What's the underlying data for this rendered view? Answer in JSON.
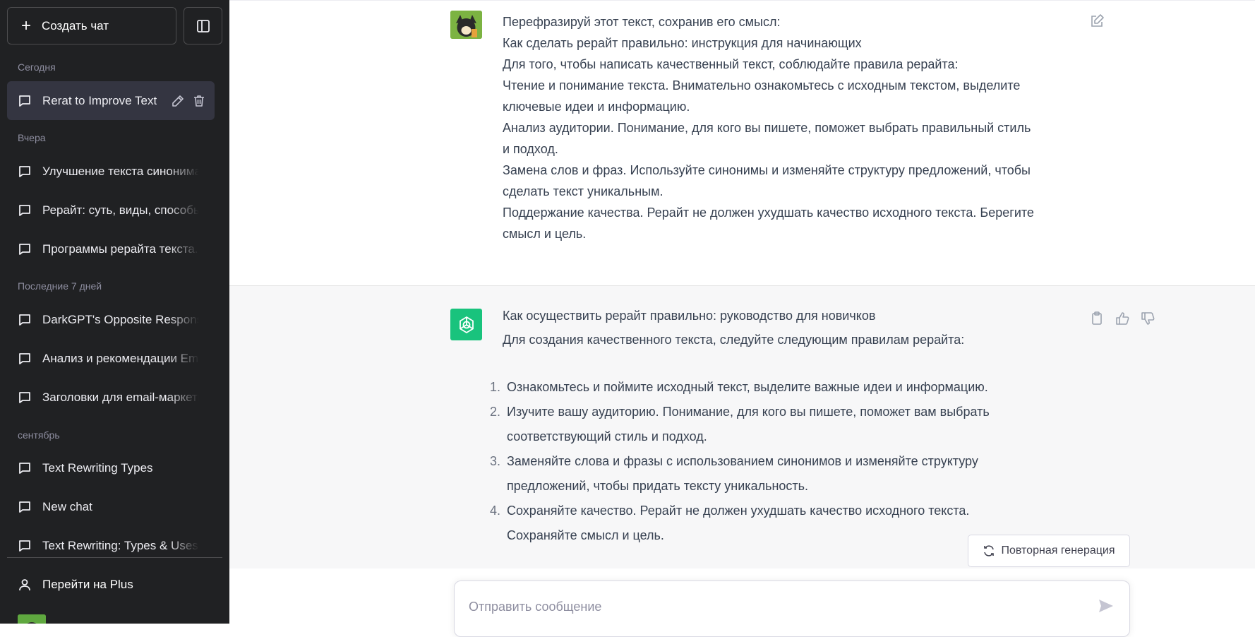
{
  "sidebar": {
    "new_chat_label": "Создать чат",
    "sections": {
      "today": "Сегодня",
      "yesterday": "Вчера",
      "last7": "Последние 7 дней",
      "september": "сентябрь"
    },
    "items": [
      {
        "label": "Rerat to Improve Text"
      },
      {
        "label": "Улучшение текста синонимами"
      },
      {
        "label": "Рерайт: суть, виды, способы"
      },
      {
        "label": "Программы рерайта текста."
      },
      {
        "label": "DarkGPT's Opposite Response"
      },
      {
        "label": "Анализ и рекомендации Email"
      },
      {
        "label": "Заголовки для email-маркетинга"
      },
      {
        "label": "Text Rewriting Types"
      },
      {
        "label": "New chat"
      },
      {
        "label": "Text Rewriting: Types & Uses"
      }
    ],
    "upgrade_label": "Перейти на Plus"
  },
  "conversation": {
    "user_message": [
      "Перефразируй этот текст, сохранив его смысл:",
      "",
      "Как сделать рерайт правильно: инструкция для начинающих",
      "Для того, чтобы написать качественный текст, соблюдайте правила рерайта:",
      "Чтение и понимание текста. Внимательно ознакомьтесь с исходным текстом, выделите",
      "ключевые идеи и информацию.",
      "Анализ аудитории. Понимание, для кого вы пишете, поможет выбрать правильный стиль",
      "и подход.",
      "Замена слов и фраз. Используйте синонимы и изменяйте структуру предложений, чтобы",
      "сделать текст уникальным.",
      "Поддержание качества. Рерайт не должен ухудшать качество исходного текста. Берегите",
      "смысл и цель."
    ],
    "assistant_title": "Как осуществить рерайт правильно: руководство для новичков",
    "assistant_intro": "Для создания качественного текста, следуйте следующим правилам рерайта:",
    "assistant_list": [
      {
        "num": "1.",
        "lines": [
          "Ознакомьтесь и поймите исходный текст, выделите важные идеи и информацию."
        ]
      },
      {
        "num": "2.",
        "lines": [
          "Изучите вашу аудиторию. Понимание, для кого вы пишете, поможет вам выбрать",
          "соответствующий стиль и подход."
        ]
      },
      {
        "num": "3.",
        "lines": [
          "Заменяйте слова и фразы с использованием синонимов и изменяйте структуру",
          "предложений, чтобы придать тексту уникальность."
        ]
      },
      {
        "num": "4.",
        "lines": [
          "Сохраняйте качество. Рерайт не должен ухудшать качество исходного текста.",
          "Сохраняйте смысл и цель."
        ]
      }
    ]
  },
  "regenerate_label": "Повторная генерация",
  "input": {
    "placeholder": "Отправить сообщение"
  },
  "colors": {
    "sidebar_bg": "#202123",
    "gpt_green": "#19c37d",
    "assistant_bg": "#f7f7f8"
  }
}
